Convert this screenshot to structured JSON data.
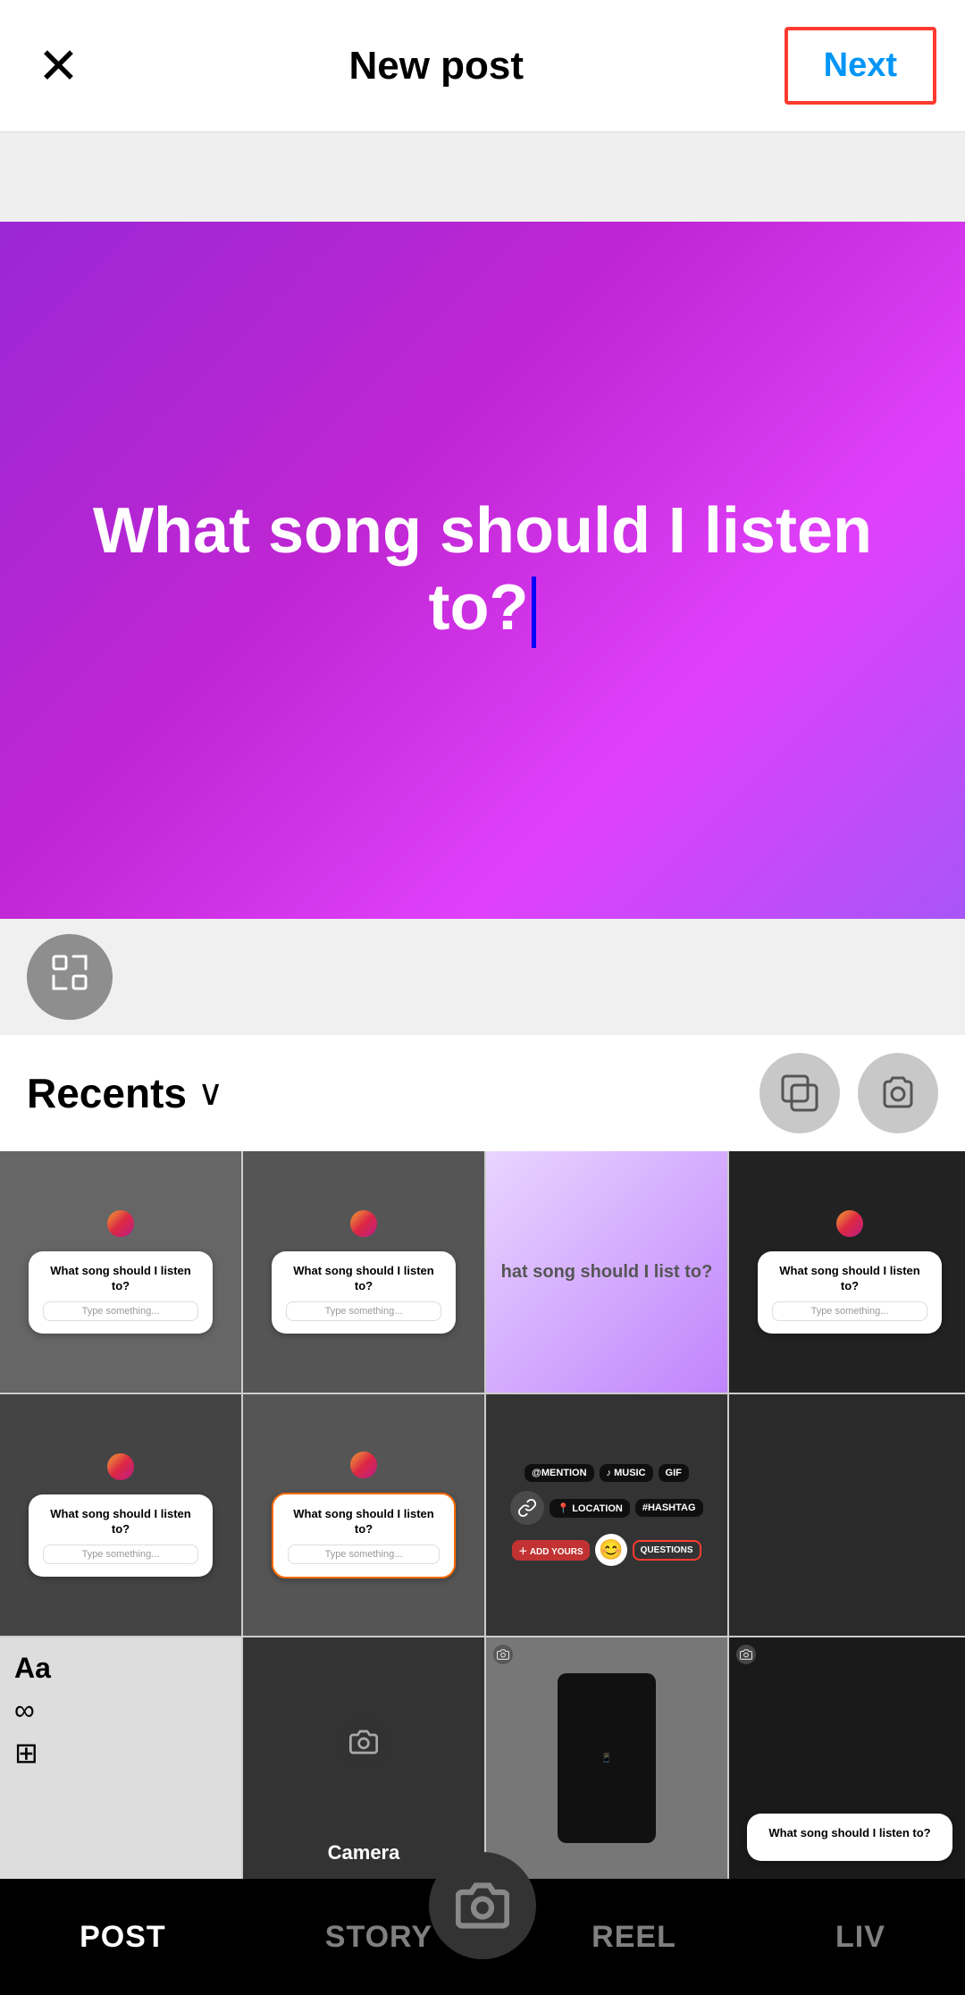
{
  "header": {
    "close_label": "✕",
    "title": "New post",
    "next_label": "Next"
  },
  "preview": {
    "text_line1": "What song should I listen",
    "text_line2": "to?",
    "cursor": true
  },
  "toolbar": {
    "expand_icon": "⊡"
  },
  "recents": {
    "label": "Recents",
    "chevron": "∨"
  },
  "grid": {
    "rows": 3,
    "cols": 4,
    "cells": [
      {
        "type": "story-card",
        "selected": false
      },
      {
        "type": "story-card",
        "selected": false
      },
      {
        "type": "story-purple",
        "selected": false
      },
      {
        "type": "story-card-dark",
        "selected": false
      },
      {
        "type": "story-card",
        "selected": false
      },
      {
        "type": "story-card-selected",
        "selected": true
      },
      {
        "type": "stickers",
        "selected": false
      },
      {
        "type": "story-card-dark-empty",
        "selected": false
      },
      {
        "type": "text-tools",
        "selected": false
      },
      {
        "type": "camera-cell",
        "selected": false
      },
      {
        "type": "story-phone",
        "selected": false
      },
      {
        "type": "story-mini",
        "selected": false
      }
    ],
    "poll_question": "What song should I listen to?",
    "poll_placeholder": "Type something..."
  },
  "bottom_nav": {
    "items": [
      "POST",
      "STORY",
      "REEL",
      "LIV"
    ],
    "active_index": 0
  },
  "stickers": {
    "mention": "@MENTION",
    "music": "♪ MUSIC",
    "gif": "GIF",
    "location": "📍 LOCATION",
    "hashtag": "#HASHTAG",
    "add_yours": "＋ ADD YOURS",
    "questions": "QUESTIONS"
  }
}
